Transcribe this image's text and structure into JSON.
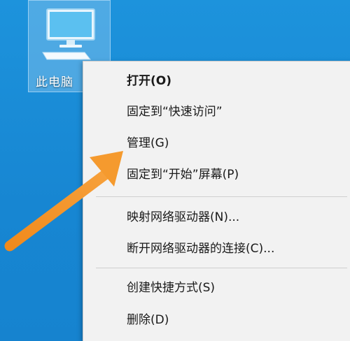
{
  "desktop": {
    "icon": {
      "label": "此电脑",
      "icon": "computer-monitor-icon"
    }
  },
  "context_menu": {
    "items": [
      {
        "label": "打开(O)",
        "bold": true
      },
      {
        "label": "固定到“快速访问”"
      },
      {
        "label": "管理(G)"
      },
      {
        "label": "固定到“开始”屏幕(P)"
      },
      {
        "label": "映射网络驱动器(N)..."
      },
      {
        "label": "断开网络驱动器的连接(C)..."
      },
      {
        "label": "创建快捷方式(S)"
      },
      {
        "label": "删除(D)"
      }
    ]
  },
  "annotation": {
    "icon": "orange-arrow-icon",
    "color": "#f39223"
  },
  "colors": {
    "desktop_background": "#1a8fd8",
    "menu_background": "#f2f2f2",
    "accent_arrow": "#f39223"
  }
}
